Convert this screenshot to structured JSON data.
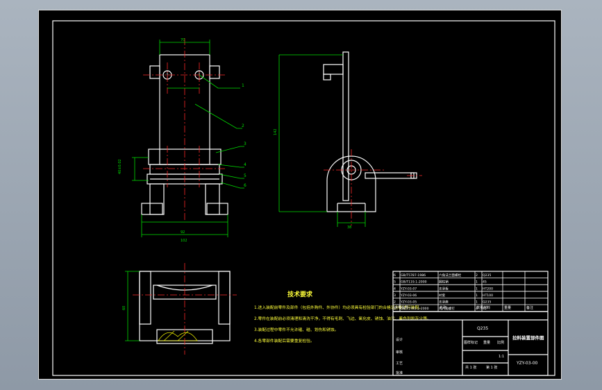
{
  "tech_req": {
    "title": "技术要求",
    "items": [
      "1.进入装配前零件及部件（包括外购件、外协件）均必须具有检验部门的合格证方能进行装配。",
      "2.零件在装配前必须清理和清洗干净，不得有毛刺、飞边、氧化皮、锈蚀、油污、着色剂和灰尘等。",
      "3.装配过程中零件不允许磕、碰、划伤和锈蚀。",
      "4.各零部件装配后需要重复检验。"
    ]
  },
  "balloons": [
    "1",
    "2",
    "3",
    "4",
    "5",
    "6"
  ],
  "dims": {
    "top_width": "70",
    "left_width": "92",
    "bottom_width": "102",
    "side_label": "40±0.02",
    "right_height": "142",
    "bracket_width": "38",
    "plan_height": "60"
  },
  "parts_rows": [
    [
      "6",
      "GB/T5787-1986",
      "六角法兰面螺栓",
      "2",
      "Q235",
      ""
    ],
    [
      "5",
      "GB/T119.1-2000",
      "圆柱销",
      "1",
      "45",
      ""
    ],
    [
      "4",
      "YZY-03-07",
      "支承板",
      "1",
      "HT200",
      ""
    ],
    [
      "3",
      "YZY-03-06",
      "衬套",
      "1",
      "HT100",
      ""
    ],
    [
      "2",
      "YZY-03-05",
      "支承座",
      "1",
      "Q235",
      ""
    ],
    [
      "1",
      "GB/T5781.1-2000",
      "内六角螺钉",
      "4",
      "45",
      ""
    ]
  ],
  "parts_header": [
    "序号",
    "代号",
    "名称",
    "数量",
    "材料",
    "重量",
    "备注"
  ],
  "title_block": {
    "material": "Q235",
    "drawing_title": "拉料装置部件图",
    "drawing_no": "YZY-03-00",
    "scale_label": "图样标记",
    "weight_label": "重量",
    "scale_label2": "比例",
    "scale_value": "1:1",
    "sheet_count": "共 1 张",
    "sheet_index": "第 1 张",
    "designer_label": "设计",
    "checker_label": "审核",
    "process_label": "工艺",
    "approve_label": "批准"
  }
}
